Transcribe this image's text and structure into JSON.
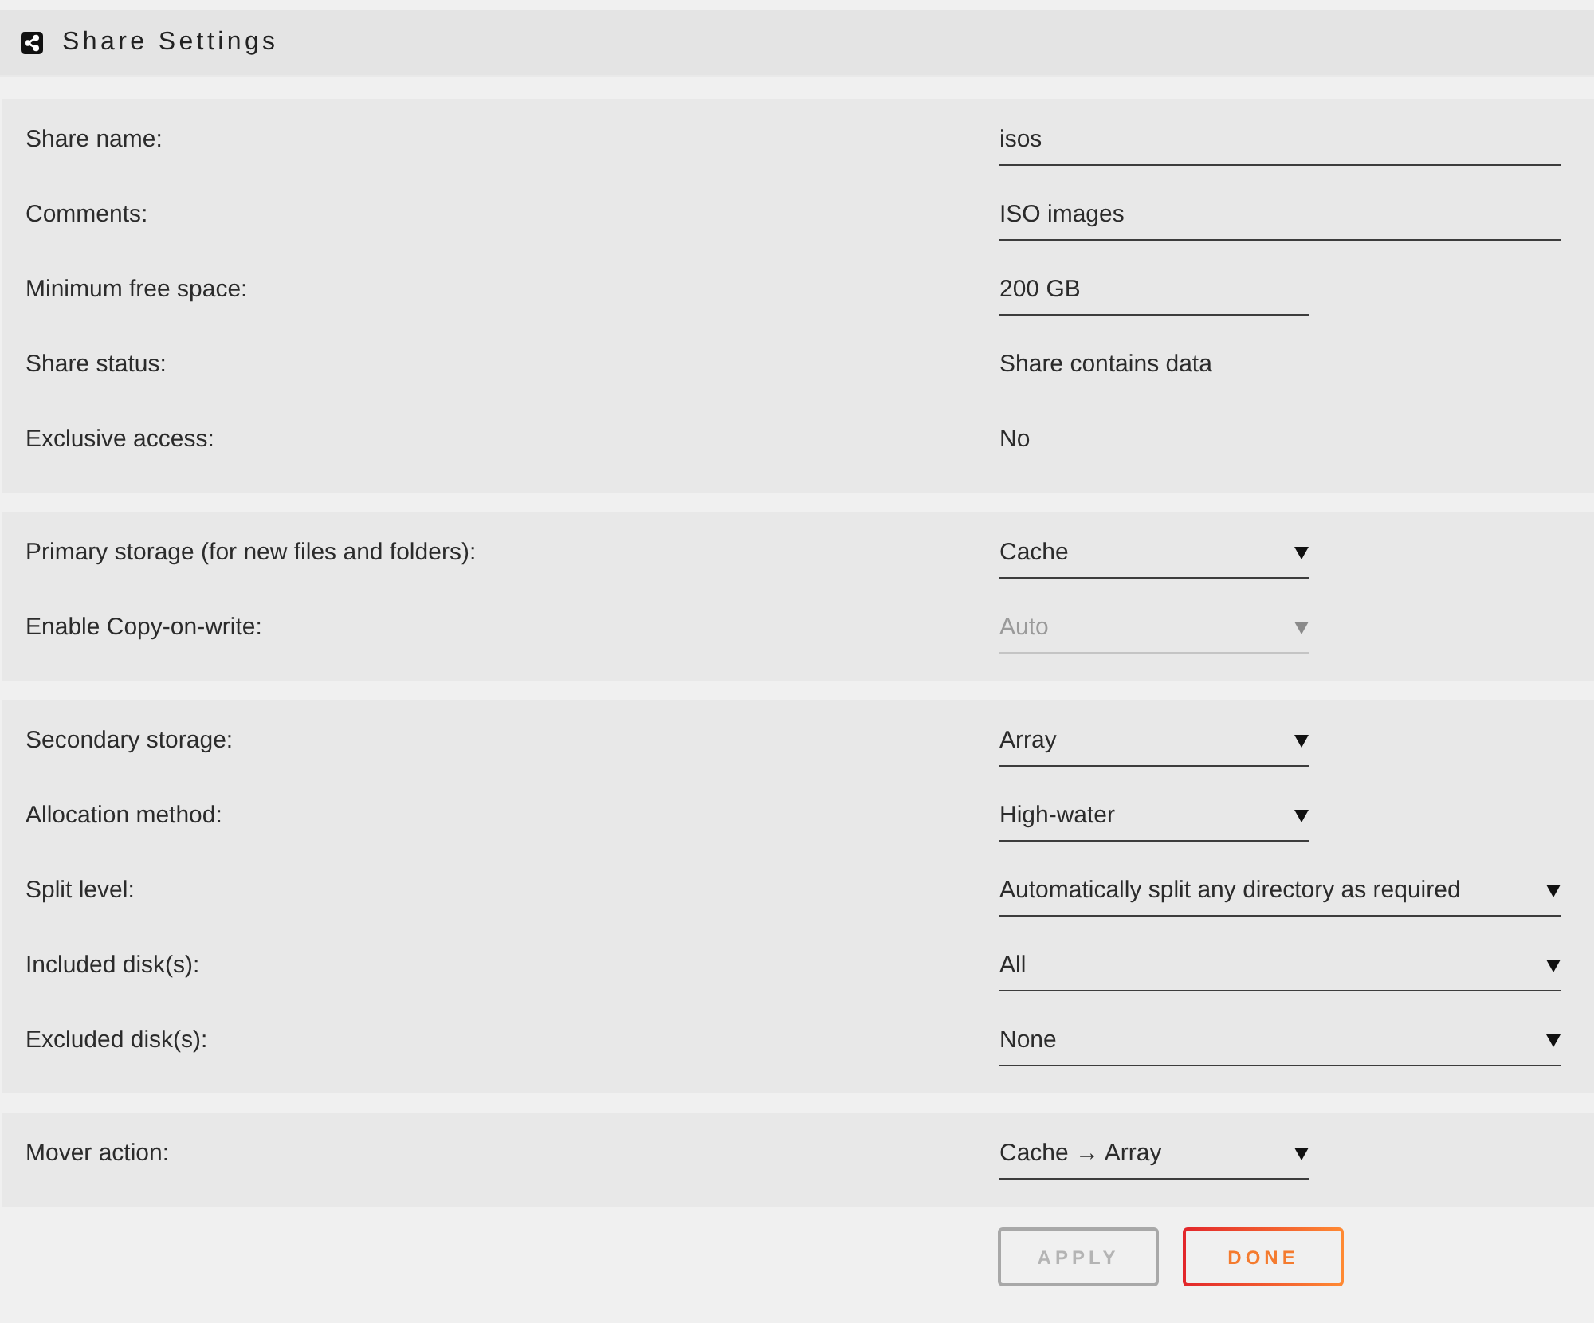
{
  "header": {
    "title": "Share Settings"
  },
  "sections": [
    {
      "rows": [
        {
          "label": "Share name:",
          "kind": "text",
          "value": "isos",
          "disabled": false
        },
        {
          "label": "Comments:",
          "kind": "text",
          "value": "ISO images",
          "disabled": false
        },
        {
          "label": "Minimum free space:",
          "kind": "short_text",
          "value": "200 GB",
          "disabled": false
        },
        {
          "label": "Share status:",
          "kind": "info",
          "value": "Share contains data",
          "disabled": false
        },
        {
          "label": "Exclusive access:",
          "kind": "info",
          "value": "No",
          "disabled": false
        }
      ]
    },
    {
      "rows": [
        {
          "label": "Primary storage (for new files and folders):",
          "kind": "select",
          "value": "Cache",
          "disabled": false
        },
        {
          "label": "Enable Copy-on-write:",
          "kind": "select",
          "value": "Auto",
          "disabled": true
        }
      ]
    },
    {
      "rows": [
        {
          "label": "Secondary storage:",
          "kind": "select",
          "value": "Array",
          "disabled": false
        },
        {
          "label": "Allocation method:",
          "kind": "select",
          "value": "High-water",
          "disabled": false
        },
        {
          "label": "Split level:",
          "kind": "wide_select",
          "value": "Automatically split any directory as required",
          "disabled": false
        },
        {
          "label": "Included disk(s):",
          "kind": "wide_select",
          "value": "All",
          "disabled": false
        },
        {
          "label": "Excluded disk(s):",
          "kind": "wide_select",
          "value": "None",
          "disabled": false
        }
      ]
    },
    {
      "rows": [
        {
          "label": "Mover action:",
          "kind": "select",
          "value": "Cache → Array",
          "disabled": false
        }
      ]
    }
  ],
  "buttons": [
    {
      "label": "APPLY",
      "disabled": true
    },
    {
      "label": "DONE",
      "disabled": false
    }
  ]
}
